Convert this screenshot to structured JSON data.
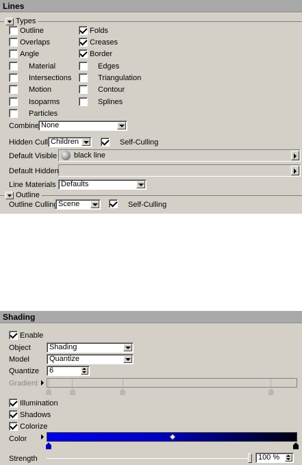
{
  "lines": {
    "title": "Lines",
    "types_section": "Types",
    "types": [
      {
        "label": "Outline",
        "checked": false
      },
      {
        "label": "Folds",
        "checked": true
      },
      {
        "label": "Overlaps",
        "checked": false
      },
      {
        "label": "Creases",
        "checked": true
      },
      {
        "label": "Angle",
        "checked": false
      },
      {
        "label": "Border",
        "checked": true
      },
      {
        "label": "Material",
        "checked": false
      },
      {
        "label": "Edges",
        "checked": false
      },
      {
        "label": "Intersections",
        "checked": false
      },
      {
        "label": "Triangulation",
        "checked": false
      },
      {
        "label": "Motion",
        "checked": false
      },
      {
        "label": "Contour",
        "checked": false
      },
      {
        "label": "Isoparms",
        "checked": false
      },
      {
        "label": "Splines",
        "checked": false
      },
      {
        "label": "Particles",
        "checked": false
      }
    ],
    "combine_label": "Combine",
    "combine_value": "None",
    "hidden_cull_label": "Hidden Cull",
    "hidden_cull_value": "Children",
    "self_culling_label": "Self-Culling",
    "self_culling_checked": true,
    "default_visible_label": "Default Visible",
    "default_visible_value": "black line",
    "default_hidden_label": "Default Hidden",
    "default_hidden_value": "",
    "line_materials_label": "Line Materials",
    "line_materials_value": "Defaults",
    "outline_section": "Outline",
    "outline_culling_label": "Outline Culling",
    "outline_culling_value": "Scene",
    "outline_self_culling_label": "Self-Culling",
    "outline_self_culling_checked": true
  },
  "shading": {
    "title": "Shading",
    "enable_label": "Enable",
    "enable_checked": true,
    "object_label": "Object",
    "object_value": "Shading",
    "model_label": "Model",
    "model_value": "Quantize",
    "quantize_label": "Quantize",
    "quantize_value": "6",
    "gradient_label": "Gradient",
    "illumination_label": "Illumination",
    "illumination_checked": true,
    "shadows_label": "Shadows",
    "shadows_checked": true,
    "colorize_label": "Colorize",
    "colorize_checked": true,
    "color_label": "Color",
    "strength_label": "Strength",
    "strength_value": "100 %",
    "strength_fraction": 1.0
  },
  "colors": {
    "panel_bg": "#d4d0c8",
    "title_bg": "#a9a9a9",
    "color_gradient_start": "#0000e8",
    "color_gradient_end": "#000010"
  },
  "icons": [
    "collapse-arrow-icon",
    "dropdown-arrow-icon",
    "expand-right-icon",
    "sphere-material-icon",
    "spinner-icon",
    "gradient-knot-icon",
    "color-knot-icon"
  ]
}
